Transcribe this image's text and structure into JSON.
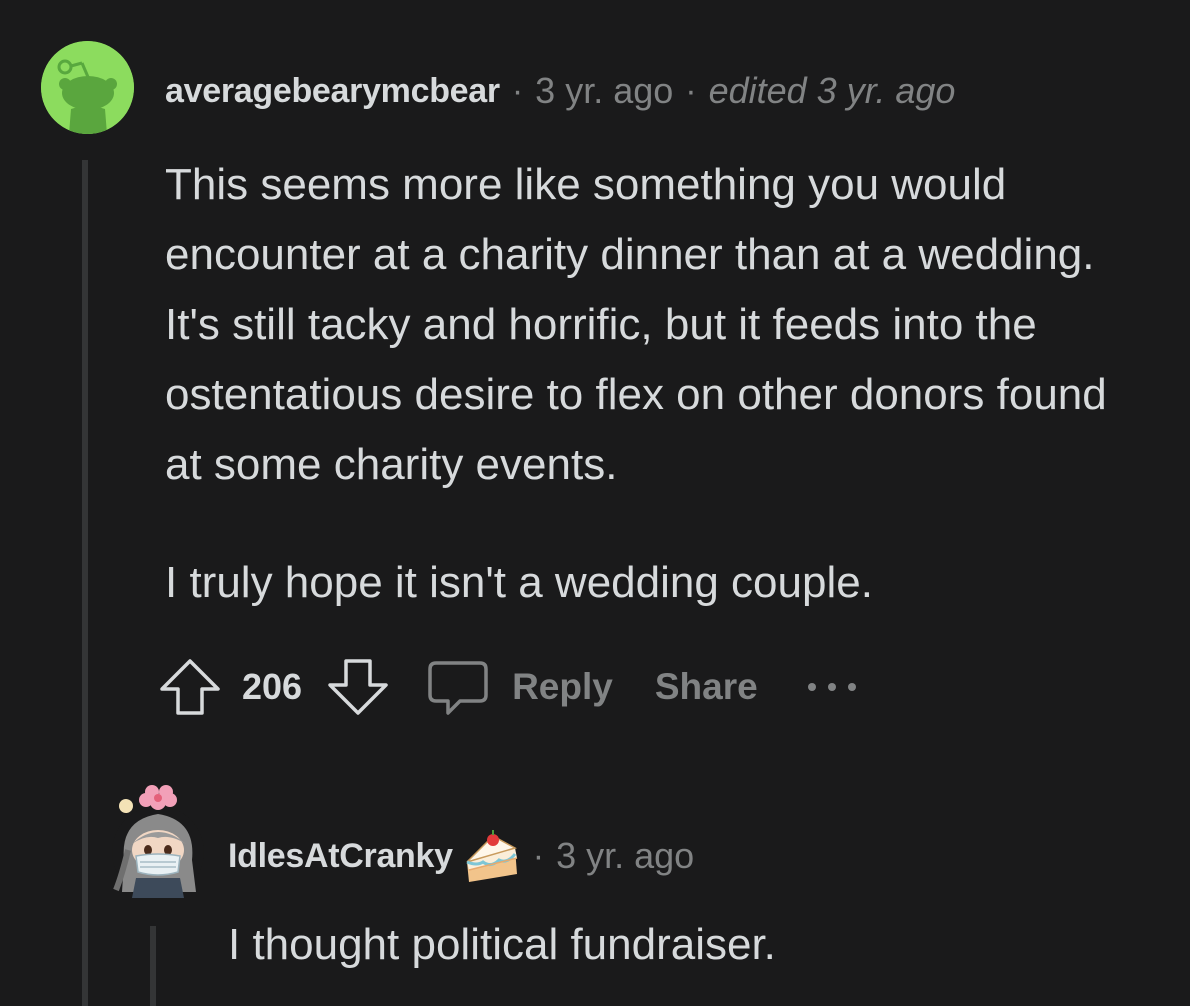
{
  "comment": {
    "username": "averagebearymcbear",
    "separator": "·",
    "age": "3 yr. ago",
    "edited": "edited 3 yr. ago",
    "paragraphs": [
      "This seems more like something you would encounter at a charity dinner than at a wedding. It's still tacky and horrific, but it feeds into the ostentatious desire to flex on other donors found at some charity events.",
      "I truly hope it isn't a wedding couple."
    ],
    "score": "206",
    "reply_label": "Reply",
    "share_label": "Share",
    "avatar_color": "#8cdc5e",
    "icons": [
      "upvote-icon",
      "downvote-icon",
      "comment-bubble-icon",
      "more-options-icon"
    ]
  },
  "reply": {
    "username": "IdlesAtCranky",
    "flair_icon": "cake-icon",
    "separator": "·",
    "age": "3 yr. ago",
    "text": "I thought political fundraiser."
  },
  "colors": {
    "background": "#1a1a1b",
    "text": "#d7dadc",
    "muted": "#818384",
    "thread_line": "#343536"
  }
}
